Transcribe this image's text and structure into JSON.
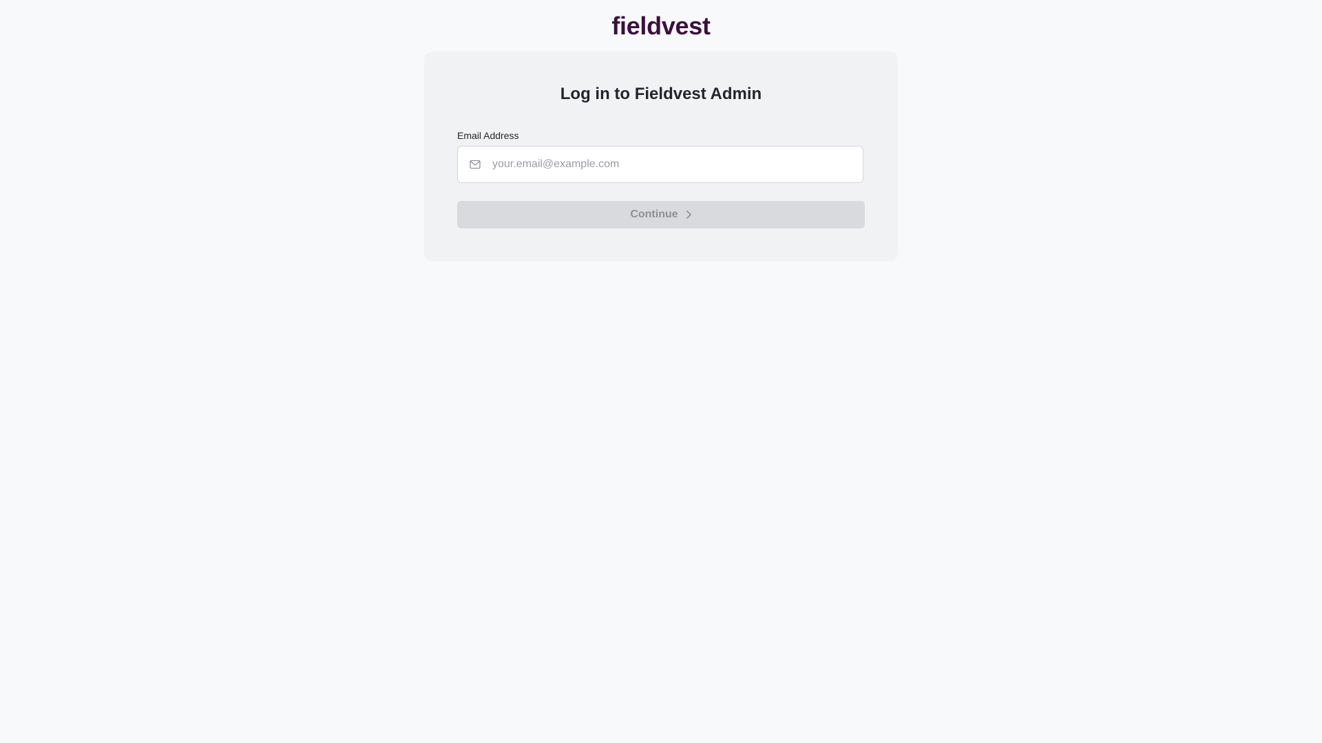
{
  "brand": {
    "logo_text": "fieldvest",
    "color": "#3b0f3e"
  },
  "login": {
    "title": "Log in to Fieldvest Admin",
    "email_label": "Email Address",
    "email_placeholder": "your.email@example.com",
    "email_value": "",
    "email_icon": "mail-icon",
    "continue_label": "Continue",
    "continue_icon": "chevron-right-icon",
    "continue_disabled": true
  }
}
